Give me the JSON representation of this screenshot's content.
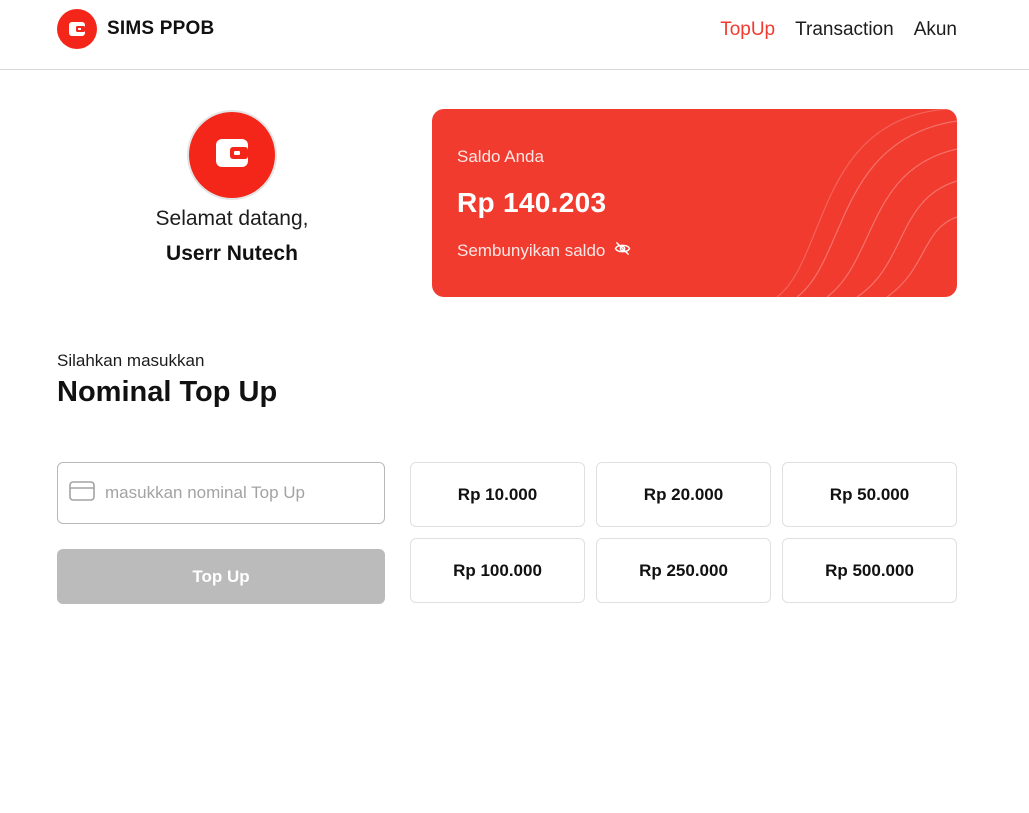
{
  "brand": {
    "name": "SIMS PPOB",
    "logo_icon": "wallet-icon",
    "color": "#f42619"
  },
  "nav": {
    "items": [
      {
        "label": "TopUp",
        "active": true
      },
      {
        "label": "Transaction",
        "active": false
      },
      {
        "label": "Akun",
        "active": false
      }
    ],
    "active_color": "#f13b2f"
  },
  "profile": {
    "avatar_icon": "wallet-icon",
    "welcome": "Selamat datang,",
    "name": "Userr Nutech"
  },
  "balance": {
    "label": "Saldo Anda",
    "amount": "Rp 140.203",
    "toggle_label": "Sembunyikan saldo",
    "toggle_icon": "eye-off-icon",
    "card_color": "#f13b2f"
  },
  "topup": {
    "subtitle": "Silahkan masukkan",
    "title": "Nominal Top Up",
    "input_placeholder": "masukkan nominal Top Up",
    "input_value": "",
    "input_icon": "credit-card-icon",
    "button_label": "Top Up",
    "button_disabled": true,
    "presets": [
      "Rp 10.000",
      "Rp 20.000",
      "Rp 50.000",
      "Rp 100.000",
      "Rp 250.000",
      "Rp 500.000"
    ]
  }
}
